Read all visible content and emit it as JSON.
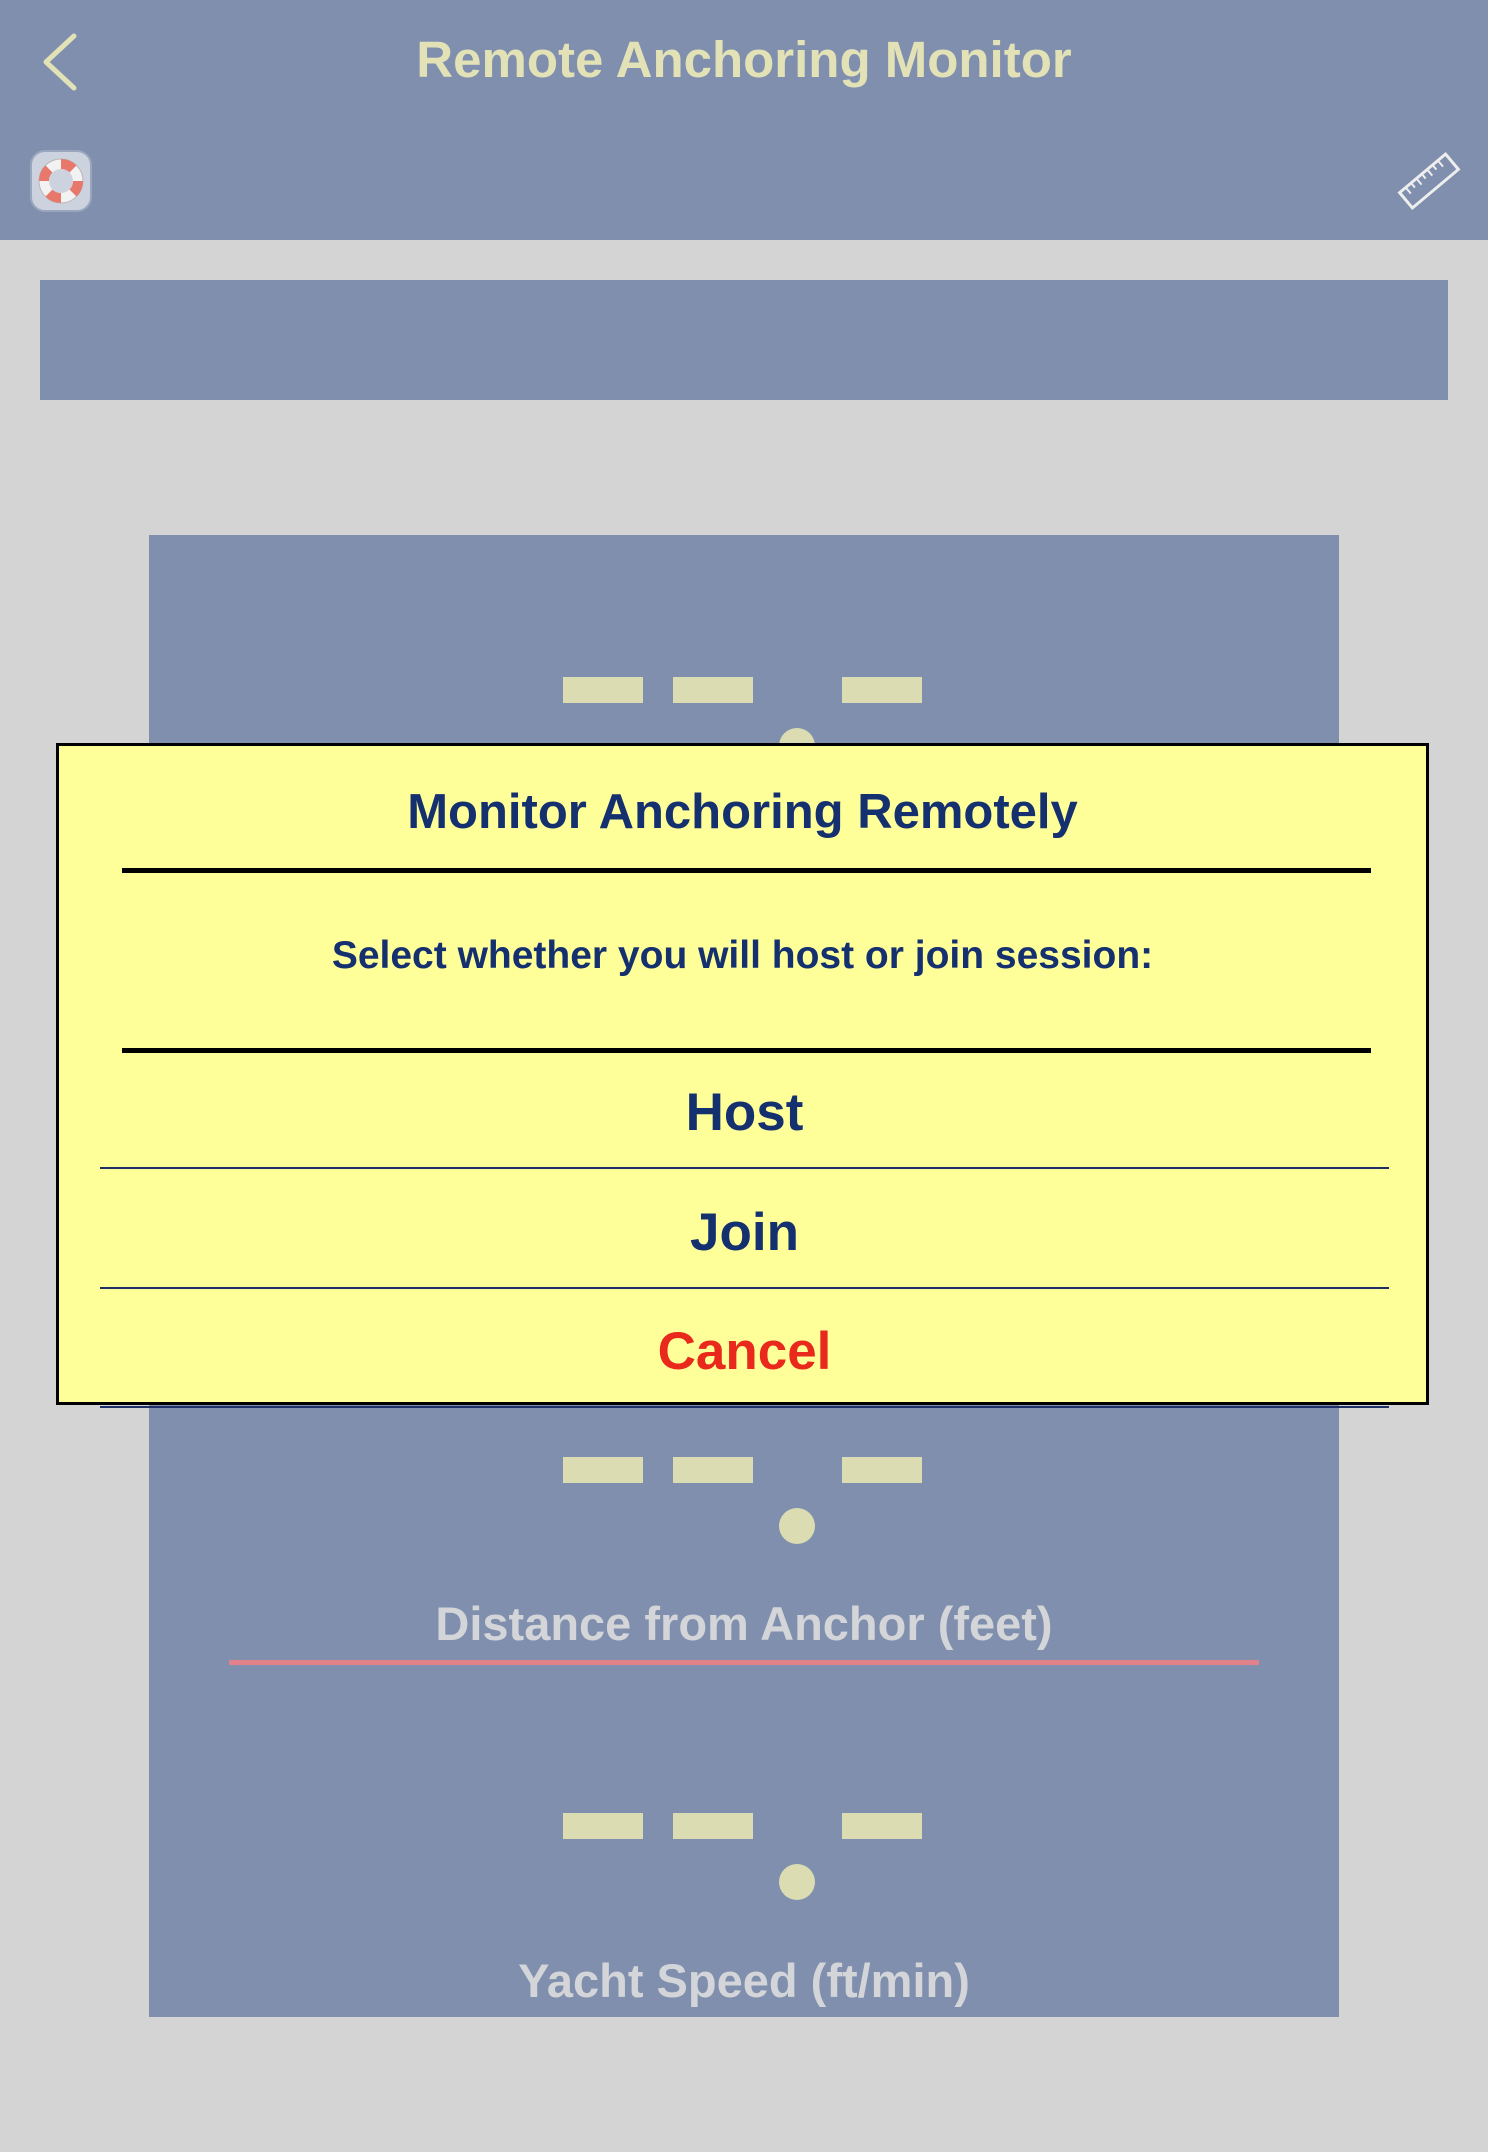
{
  "header": {
    "title": "Remote Anchoring Monitor",
    "back_icon": "chevron-left-icon",
    "left_icon": "lifebuoy-icon",
    "right_icon": "ruler-icon"
  },
  "readouts": [
    {
      "label": "Distance from Anchor (feet)"
    },
    {
      "label": "Yacht Speed (ft/min)"
    }
  ],
  "dialog": {
    "title": "Monitor Anchoring Remotely",
    "message": "Select whether you will host or join session:",
    "options": [
      {
        "label": "Host"
      },
      {
        "label": "Join"
      },
      {
        "label": "Cancel"
      }
    ]
  },
  "colors": {
    "bar": "#7f8fad",
    "background": "#d4d4d4",
    "title_text": "#e2e2b6",
    "dialog_bg": "#ffff99",
    "dialog_text": "#15306f",
    "cancel_text": "#e8291c",
    "underline": "#e1818a"
  }
}
